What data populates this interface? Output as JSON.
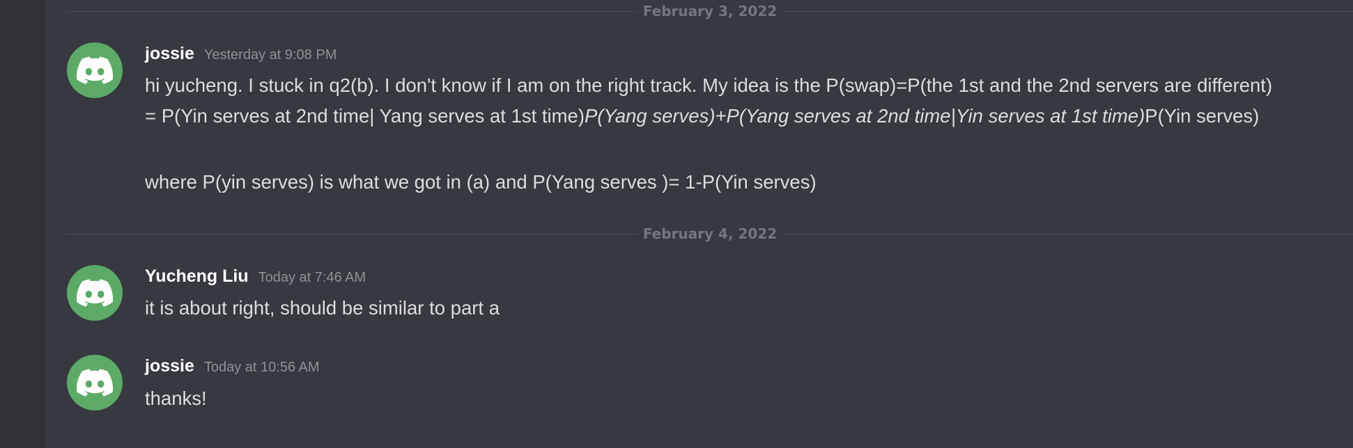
{
  "colors": {
    "background": "#36393f",
    "sidebar": "#2f3136",
    "avatar": "#5daa68",
    "username": "#ffffff",
    "timestamp": "#8e9297",
    "message_text": "#dcddde",
    "date_divider": "#72767d"
  },
  "dividers": [
    {
      "date": "February 3, 2022"
    },
    {
      "date": "February 4, 2022"
    }
  ],
  "messages": [
    {
      "avatar_icon": "discord-logo-icon",
      "username": "jossie",
      "timestamp": "Yesterday at 9:08 PM",
      "paragraph1": {
        "part1": "hi yucheng. I stuck in q2(b). I don't know if I am on the right track. My idea is the P(swap)=P(the 1st and the 2nd servers are different) = P(Yin serves at 2nd time| Yang serves at 1st time)",
        "part2_italic": "P(Yang serves)+P(Yang serves at 2nd time|Yin serves at 1st time)",
        "part3": "P(Yin serves)"
      },
      "paragraph2": "where P(yin serves) is what we got in (a) and P(Yang serves )= 1-P(Yin serves)"
    },
    {
      "avatar_icon": "discord-logo-icon",
      "username": "Yucheng Liu",
      "timestamp": "Today at 7:46 AM",
      "text": "it is about right, should be similar to part a"
    },
    {
      "avatar_icon": "discord-logo-icon",
      "username": "jossie",
      "timestamp": "Today at 10:56 AM",
      "text": "thanks!"
    }
  ]
}
